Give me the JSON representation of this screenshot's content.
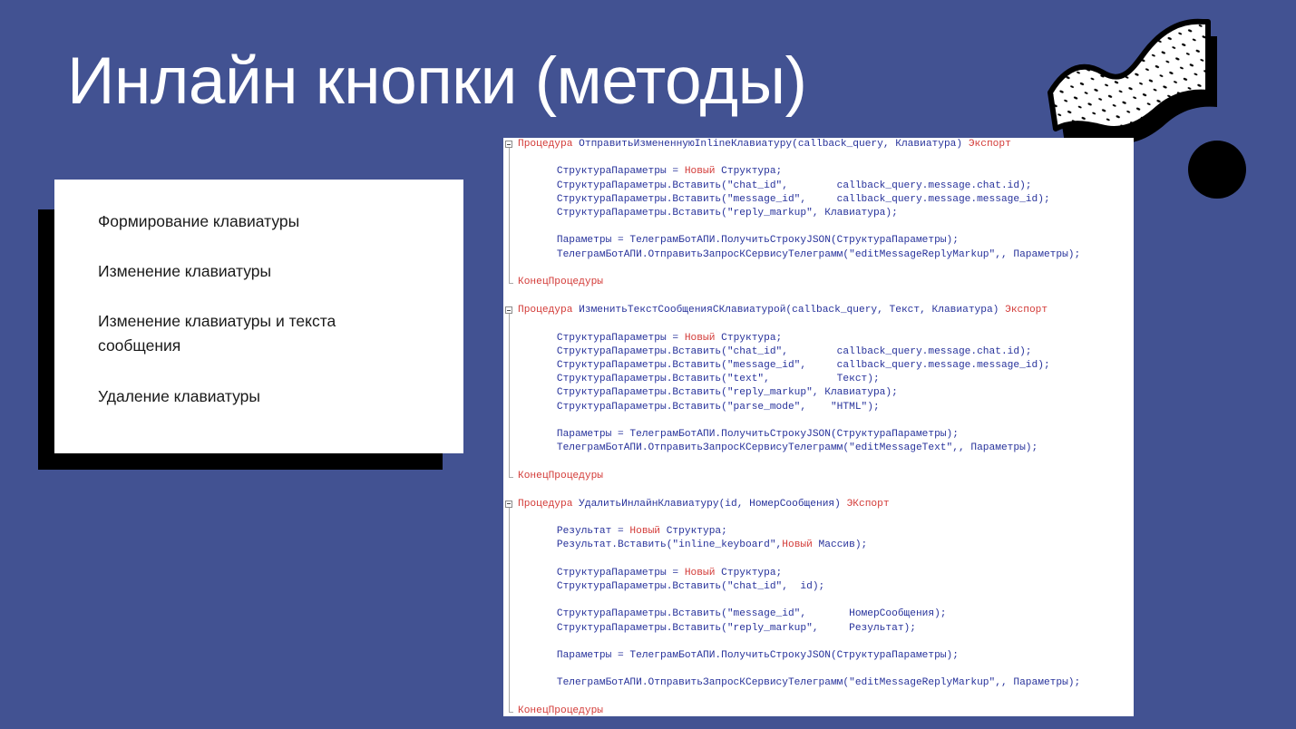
{
  "slide": {
    "title": "Инлайн кнопки (методы)",
    "background_color": "#425292",
    "accent_black": "#000000",
    "card_background": "#ffffff"
  },
  "list_card": {
    "items": [
      "Формирование клавиатуры",
      "Изменение клавиатуры",
      "Изменение клавиатуры и текста сообщения",
      "Удаление клавиатуры"
    ]
  },
  "decorations": {
    "ribbon_shape": "speckled-wave-ribbon",
    "circle_shape": "solid-circle",
    "ribbon_fill": "#ffffff",
    "ribbon_speckle": "#000000"
  },
  "code_panel": {
    "language": "1C:Enterprise",
    "keyword_color": "#d33b38",
    "identifier_color": "#27329b",
    "background": "#ffffff",
    "procedures": [
      {
        "header": {
          "keyword": "Процедура",
          "signature": " ОтправитьИзмененнуюInlineКлавиатуру(callback_query, Клавиатура) ",
          "export": "Экспорт"
        },
        "lines": [
          "",
          "    СтруктураПараметры = §Новый§ Структура;",
          "    СтруктураПараметры.Вставить(\"chat_id\",        callback_query.message.chat.id);",
          "    СтруктураПараметры.Вставить(\"message_id\",     callback_query.message.message_id);",
          "    СтруктураПараметры.Вставить(\"reply_markup\", Клавиатура);",
          "",
          "    Параметры = ТелеграмБотАПИ.ПолучитьСтрокуJSON(СтруктураПараметры);",
          "    ТелеграмБотАПИ.ОтправитьЗапросКСервисуТелеграмм(\"editMessageReplyMarkup\",, Параметры);",
          ""
        ],
        "footer": "КонецПроцедуры"
      },
      {
        "header": {
          "keyword": "Процедура",
          "signature": " ИзменитьТекстСообщенияСКлавиатурой(callback_query, Текст, Клавиатура) ",
          "export": "Экспорт"
        },
        "lines": [
          "",
          "    СтруктураПараметры = §Новый§ Структура;",
          "    СтруктураПараметры.Вставить(\"chat_id\",        callback_query.message.chat.id);",
          "    СтруктураПараметры.Вставить(\"message_id\",     callback_query.message.message_id);",
          "    СтруктураПараметры.Вставить(\"text\",           Текст);",
          "    СтруктураПараметры.Вставить(\"reply_markup\", Клавиатура);",
          "    СтруктураПараметры.Вставить(\"parse_mode\",    \"HTML\");",
          "",
          "    Параметры = ТелеграмБотАПИ.ПолучитьСтрокуJSON(СтруктураПараметры);",
          "    ТелеграмБотАПИ.ОтправитьЗапросКСервисуТелеграмм(\"editMessageText\",, Параметры);",
          ""
        ],
        "footer": "КонецПроцедуры"
      },
      {
        "header": {
          "keyword": "Процедура",
          "signature": " УдалитьИнлайнКлавиатуру(id, НомерСообщения) ",
          "export": "ЭКспорт"
        },
        "lines": [
          "",
          "    Результат = §Новый§ Структура;",
          "    Результат.Вставить(\"inline_keyboard\",§Новый§ Массив);",
          "",
          "    СтруктураПараметры = §Новый§ Структура;",
          "    СтруктураПараметры.Вставить(\"chat_id\",  id);",
          "",
          "    СтруктураПараметры.Вставить(\"message_id\",       НомерСообщения);",
          "    СтруктураПараметры.Вставить(\"reply_markup\",     Результат);",
          "",
          "    Параметры = ТелеграмБотАПИ.ПолучитьСтрокуJSON(СтруктураПараметры);",
          "",
          "    ТелеграмБотАПИ.ОтправитьЗапросКСервисуТелеграмм(\"editMessageReplyMarkup\",, Параметры);",
          ""
        ],
        "footer": "КонецПроцедуры"
      }
    ]
  }
}
